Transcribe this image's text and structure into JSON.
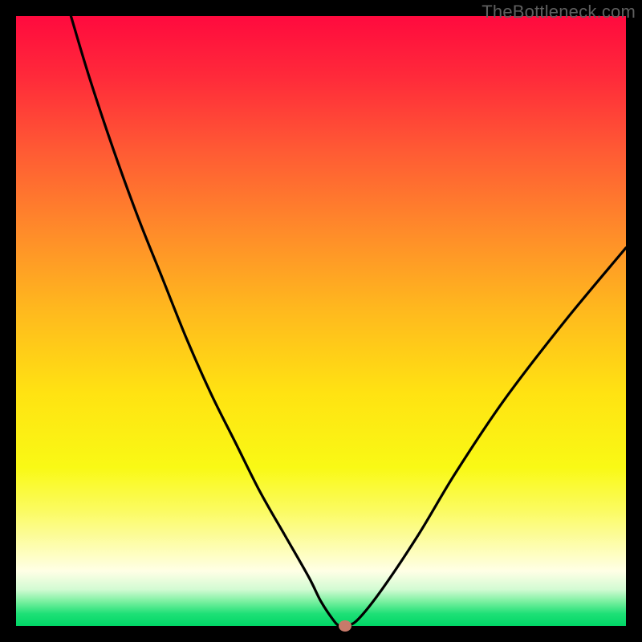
{
  "watermark": "TheBottleneck.com",
  "chart_data": {
    "type": "line",
    "title": "",
    "xlabel": "",
    "ylabel": "",
    "xlim": [
      0,
      100
    ],
    "ylim": [
      0,
      100
    ],
    "grid": false,
    "legend": false,
    "background_gradient": {
      "top": "#ff0a3e",
      "middle": "#ffe312",
      "bottom": "#00d666"
    },
    "series": [
      {
        "name": "bottleneck-curve",
        "color": "#000000",
        "x": [
          9,
          12,
          16,
          20,
          24,
          28,
          32,
          36,
          40,
          44,
          48,
          50,
          52,
          53,
          54,
          56,
          60,
          66,
          72,
          80,
          90,
          100
        ],
        "y": [
          100,
          90,
          78,
          67,
          57,
          47,
          38,
          30,
          22,
          15,
          8,
          4,
          1,
          0,
          0,
          1,
          6,
          15,
          25,
          37,
          50,
          62
        ]
      }
    ],
    "marker": {
      "name": "highlight-dot",
      "color": "#c87a6a",
      "x": 54,
      "y": 0
    }
  }
}
